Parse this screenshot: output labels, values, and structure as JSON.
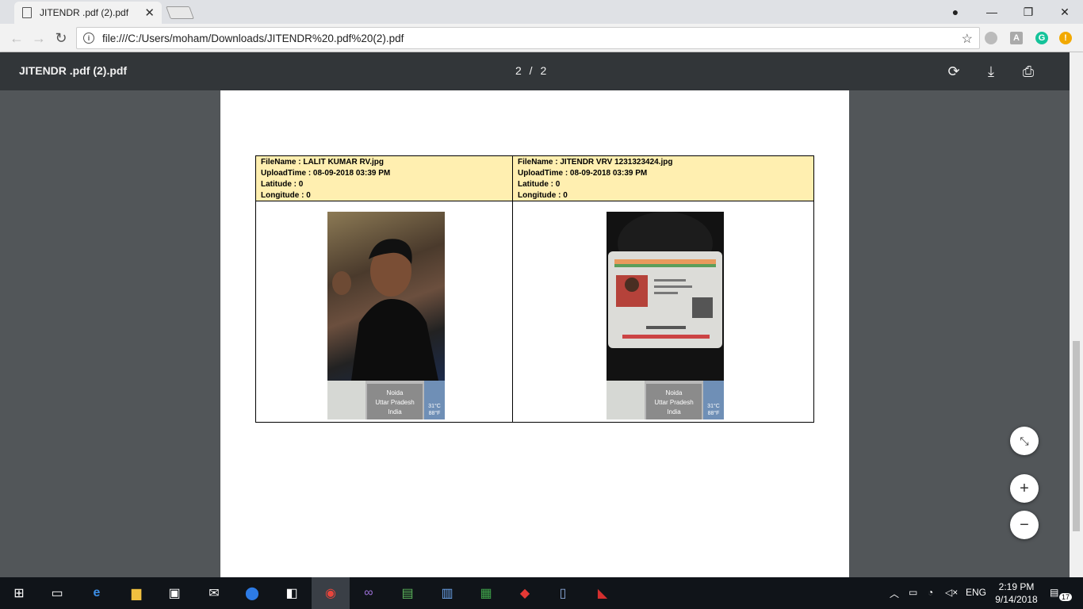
{
  "browser": {
    "tab_title": "JITENDR .pdf (2).pdf",
    "url": "file:///C:/Users/moham/Downloads/JITENDR%20.pdf%20(2).pdf"
  },
  "pdf_viewer": {
    "title": "JITENDR .pdf (2).pdf",
    "page_indicator": "2 / 2"
  },
  "records": [
    {
      "filename": "FileName : LALIT KUMAR RV.jpg",
      "uploadtime": "UploadTime : 08-09-2018 03:39 PM",
      "latitude": "Latitude : 0",
      "longitude": "Longitude : 0",
      "stamp": {
        "city": "Noida",
        "state": "Uttar Pradesh",
        "country": "India",
        "temp_c": "31°C",
        "temp_f": "88°F"
      }
    },
    {
      "filename": "FileName : JITENDR VRV 1231323424.jpg",
      "uploadtime": "UploadTime : 08-09-2018 03:39 PM",
      "latitude": "Latitude : 0",
      "longitude": "Longitude : 0",
      "stamp": {
        "city": "Noida",
        "state": "Uttar Pradesh",
        "country": "India",
        "temp_c": "31°C",
        "temp_f": "88°F"
      }
    }
  ],
  "taskbar": {
    "language": "ENG",
    "time": "2:19 PM",
    "date": "9/14/2018",
    "notifications": "17"
  },
  "colors": {
    "pdf_toolbar": "#323639",
    "viewer_bg": "#525659",
    "meta_bg": "#ffefb0",
    "taskbar": "#101419"
  }
}
